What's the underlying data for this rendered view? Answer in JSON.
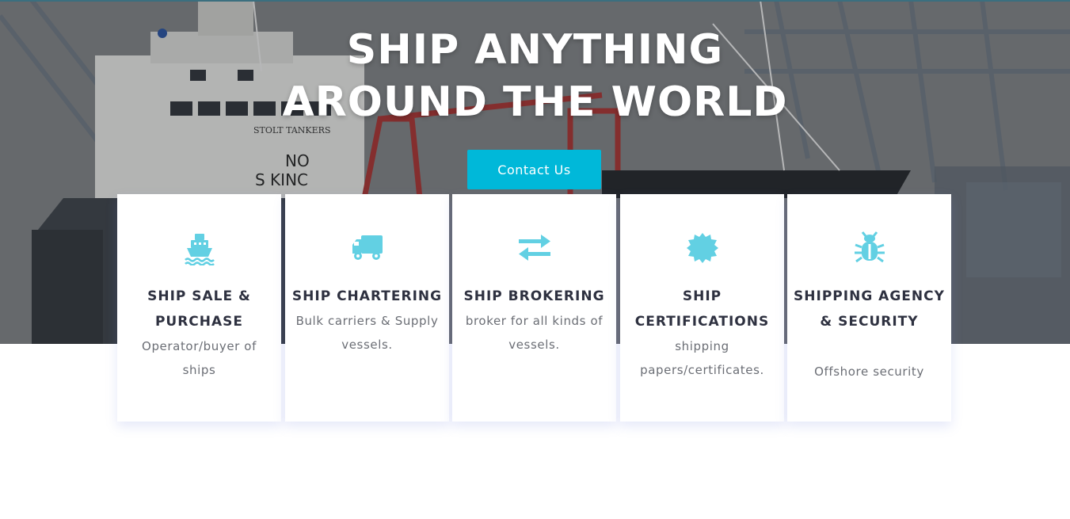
{
  "hero": {
    "title_line1": "SHIP ANYTHING",
    "title_line2": "AROUND THE WORLD",
    "cta_label": "Contact Us",
    "hull_text_1": "STOLT TANKERS",
    "hull_text_2": "NO",
    "hull_text_3": "S  KINC",
    "accent_color": "#00b8d9"
  },
  "services": [
    {
      "icon": "ship-icon",
      "title": "SHIP SALE & PURCHASE",
      "desc": "Operator/buyer of ships"
    },
    {
      "icon": "truck-icon",
      "title": "SHIP CHARTERING",
      "desc": "Bulk carriers & Supply vessels."
    },
    {
      "icon": "exchange-arrows-icon",
      "title": "SHIP BROKERING",
      "desc": "broker for all kinds of vessels."
    },
    {
      "icon": "certificate-badge-icon",
      "title": "SHIP CERTIFICATIONS",
      "desc": "shipping papers/certificates."
    },
    {
      "icon": "bug-icon",
      "title": "SHIPPING AGENCY & SECURITY",
      "desc": "Offshore security"
    }
  ],
  "colors": {
    "icon": "#62d0e3",
    "title": "#2e3140",
    "text": "#6b6e75"
  }
}
